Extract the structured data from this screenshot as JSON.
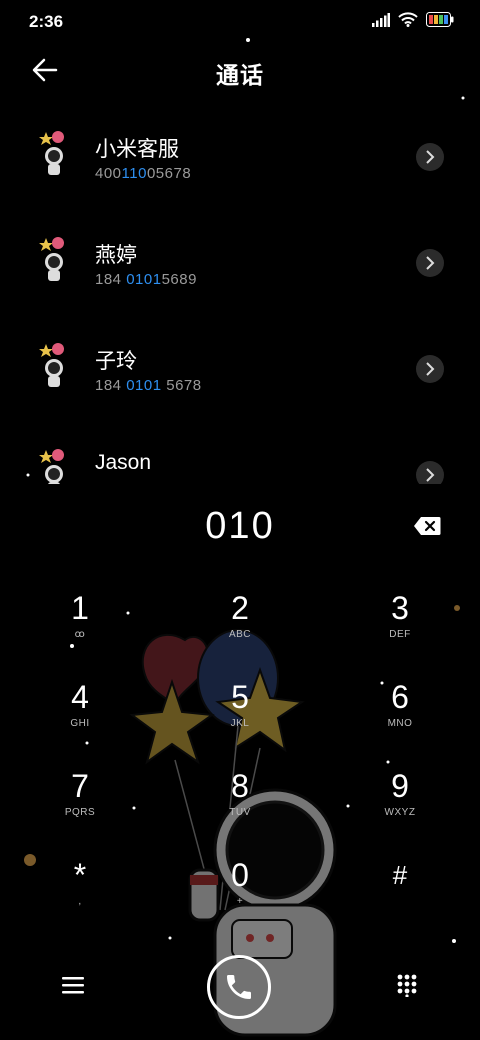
{
  "status": {
    "time": "2:36"
  },
  "header": {
    "title": "通话"
  },
  "contacts": [
    {
      "name": "小米客服",
      "number_pre": "400",
      "number_hl": "10",
      "number_post": "05678",
      "number_hl_prefix": "1"
    },
    {
      "name": "燕婷",
      "number_pre": "184 ",
      "number_hl": "0101",
      "number_post": "5689"
    },
    {
      "name": "子玲",
      "number_pre": "184 ",
      "number_hl": "0101",
      "number_post": " 5678"
    },
    {
      "name": "Jason",
      "number_pre": "",
      "number_hl": "",
      "number_post": ""
    }
  ],
  "dialer": {
    "entered": "010"
  },
  "keys": [
    {
      "digit": "1",
      "letters": "ꝏ"
    },
    {
      "digit": "2",
      "letters": "ABC"
    },
    {
      "digit": "3",
      "letters": "DEF"
    },
    {
      "digit": "4",
      "letters": "GHI"
    },
    {
      "digit": "5",
      "letters": "JKL"
    },
    {
      "digit": "6",
      "letters": "MNO"
    },
    {
      "digit": "7",
      "letters": "PQRS"
    },
    {
      "digit": "8",
      "letters": "TUV"
    },
    {
      "digit": "9",
      "letters": "WXYZ"
    },
    {
      "digit": "*",
      "letters": ","
    },
    {
      "digit": "0",
      "letters": "+"
    },
    {
      "digit": "#",
      "letters": ""
    }
  ],
  "colors": {
    "highlight": "#2e8ff0",
    "background": "#000000",
    "secondary_text": "#9a9a9a"
  },
  "icons": {
    "back": "arrow-left-icon",
    "chevron": "chevron-right-icon",
    "backspace": "backspace-icon",
    "menu": "menu-icon",
    "call": "phone-icon",
    "keypad": "keypad-grid-icon"
  }
}
